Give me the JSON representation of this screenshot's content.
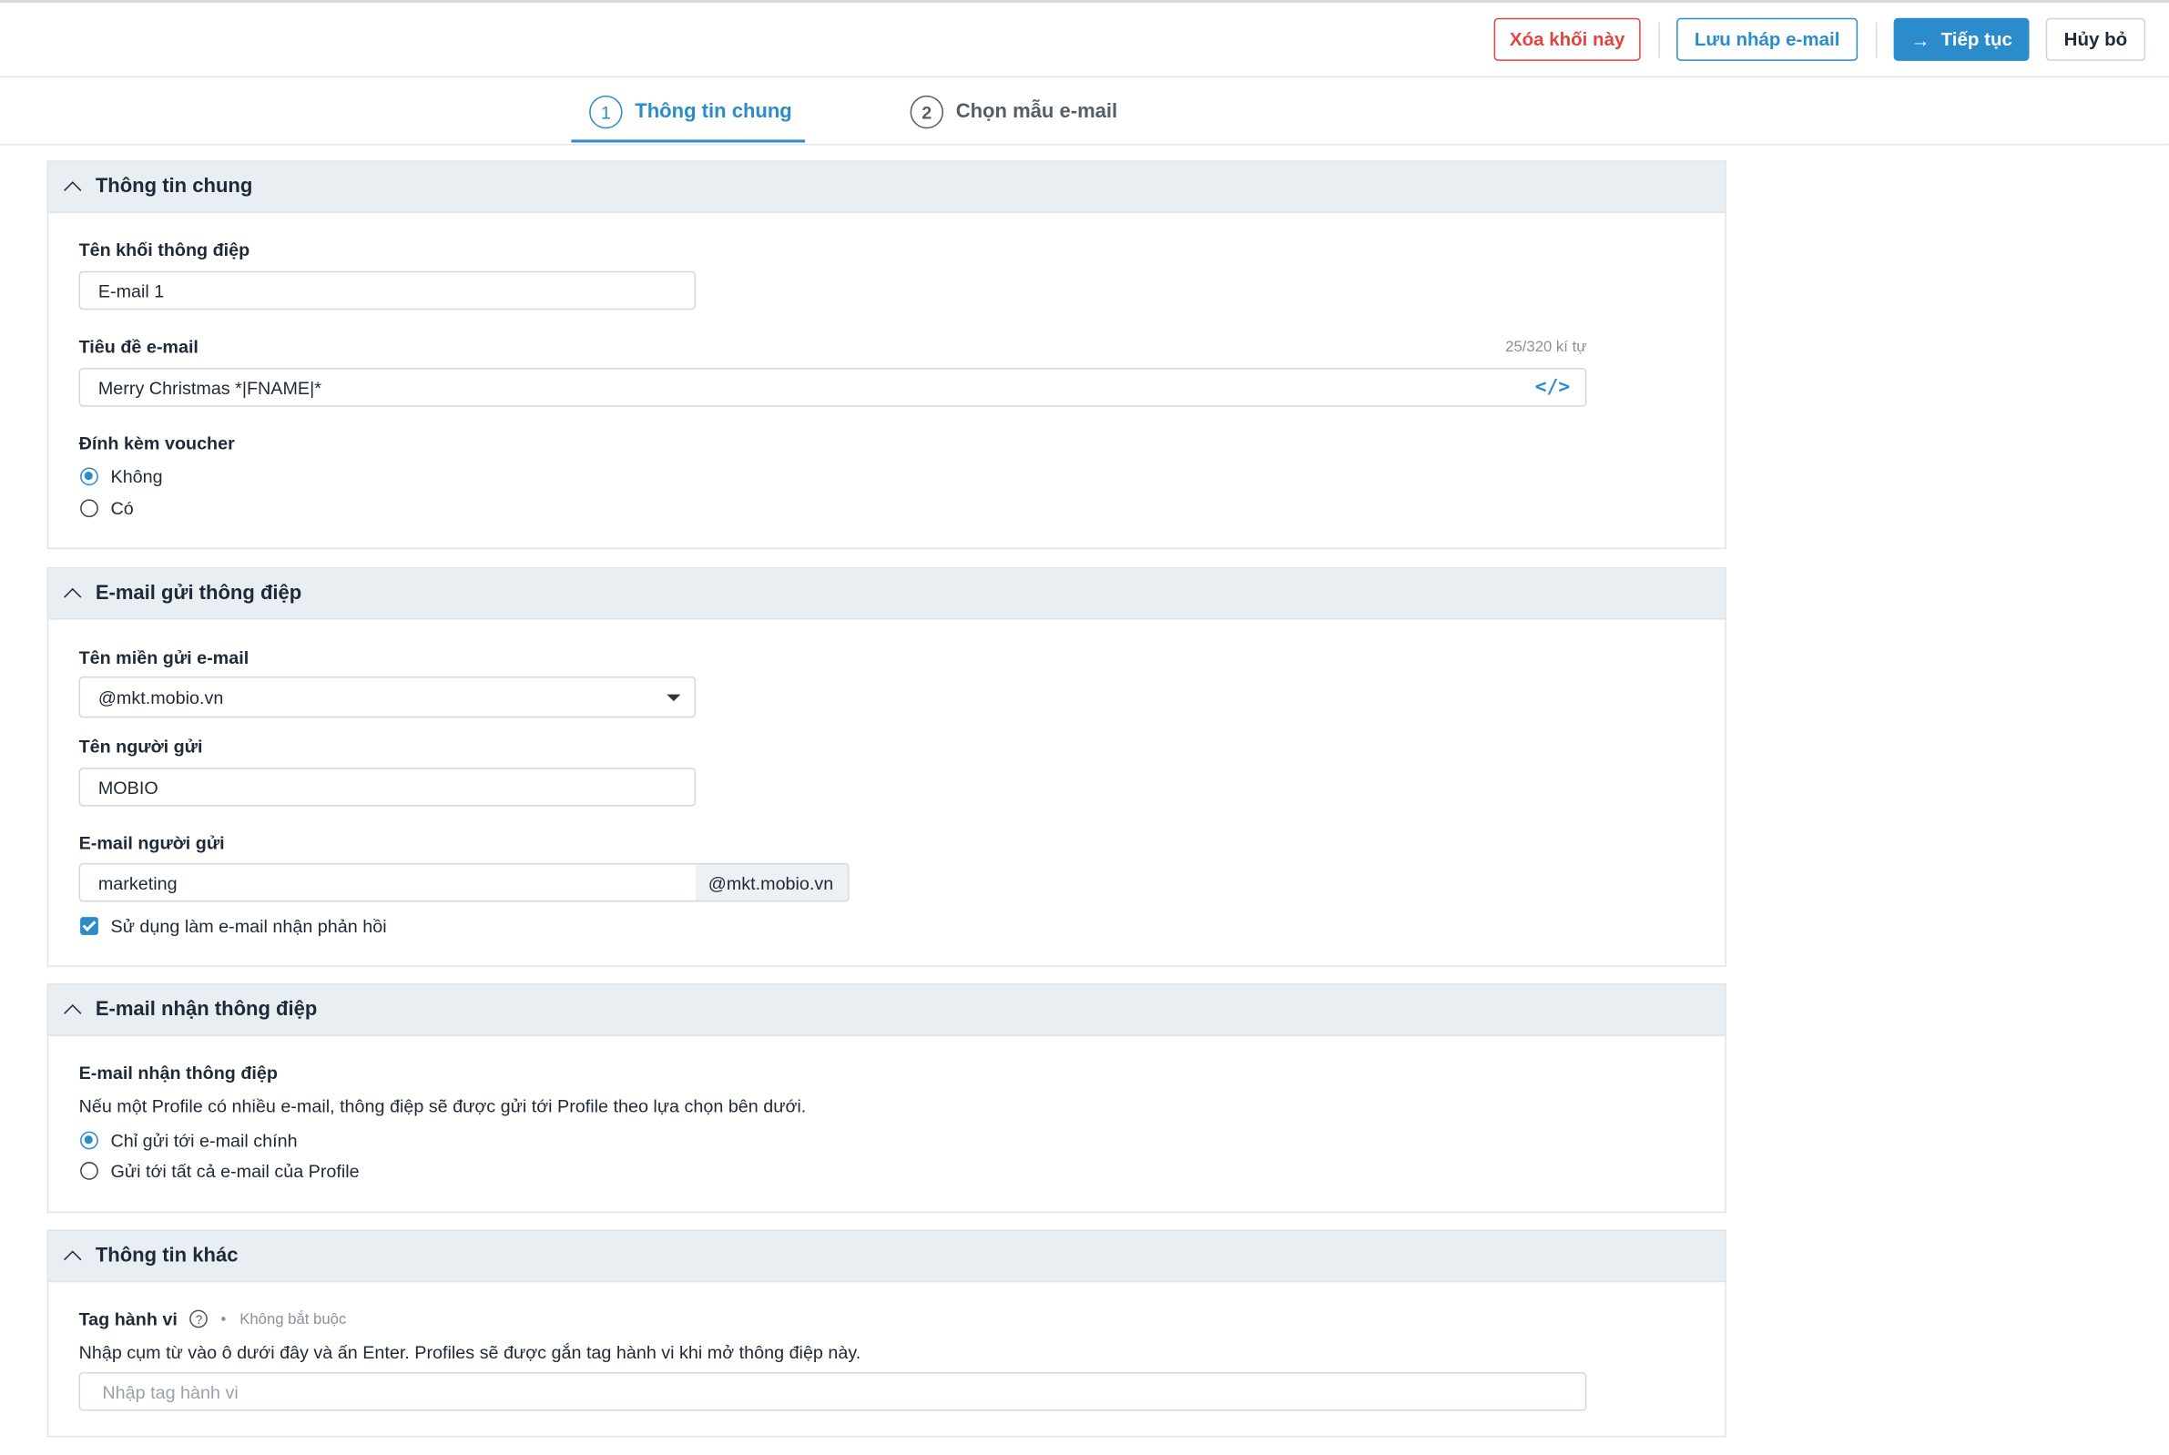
{
  "toolbar": {
    "delete_label": "Xóa khối này",
    "draft_label": "Lưu nháp e-mail",
    "continue_label": "Tiếp tục",
    "cancel_label": "Hủy bỏ"
  },
  "steps": [
    {
      "num": "1",
      "label": "Thông tin chung",
      "active": true
    },
    {
      "num": "2",
      "label": "Chọn mẫu e-mail",
      "active": false
    }
  ],
  "general": {
    "title": "Thông tin chung",
    "block_name_label": "Tên khối thông điệp",
    "block_name_value": "E-mail 1",
    "subject_label": "Tiêu đề e-mail",
    "subject_counter": "25/320 kí tự",
    "subject_value": "Merry Christmas *|FNAME|*",
    "voucher_label": "Đính kèm voucher",
    "voucher_options": [
      "Không",
      "Có"
    ],
    "voucher_selected": "Không"
  },
  "sender": {
    "title": "E-mail gửi thông điệp",
    "domain_label": "Tên miền gửi e-mail",
    "domain_value": "@mkt.mobio.vn",
    "name_label": "Tên người gửi",
    "name_value": "MOBIO",
    "email_label": "E-mail người gửi",
    "email_value": "marketing",
    "email_suffix": "@mkt.mobio.vn",
    "reply_checkbox_label": "Sử dụng làm e-mail nhận phản hồi",
    "reply_checked": true
  },
  "receiver": {
    "title": "E-mail nhận thông điệp",
    "label": "E-mail nhận thông điệp",
    "description": "Nếu một Profile có nhiều e-mail, thông điệp sẽ được gửi tới Profile theo lựa chọn bên dưới.",
    "options": [
      "Chỉ gửi tới e-mail chính",
      "Gửi tới tất cả e-mail của Profile"
    ],
    "selected": "Chỉ gửi tới e-mail chính"
  },
  "other": {
    "title": "Thông tin khác",
    "tag_label": "Tag hành vi",
    "optional": "Không bắt buộc",
    "description": "Nhập cụm từ vào ô dưới đây và ấn Enter. Profiles sẽ được gắn tag hành vi khi mở thông điệp này.",
    "tag_placeholder": "Nhập tag hành vi"
  },
  "colors": {
    "accent": "#2a8ccb",
    "danger": "#e2443d",
    "panel_header": "#e9eef3"
  }
}
